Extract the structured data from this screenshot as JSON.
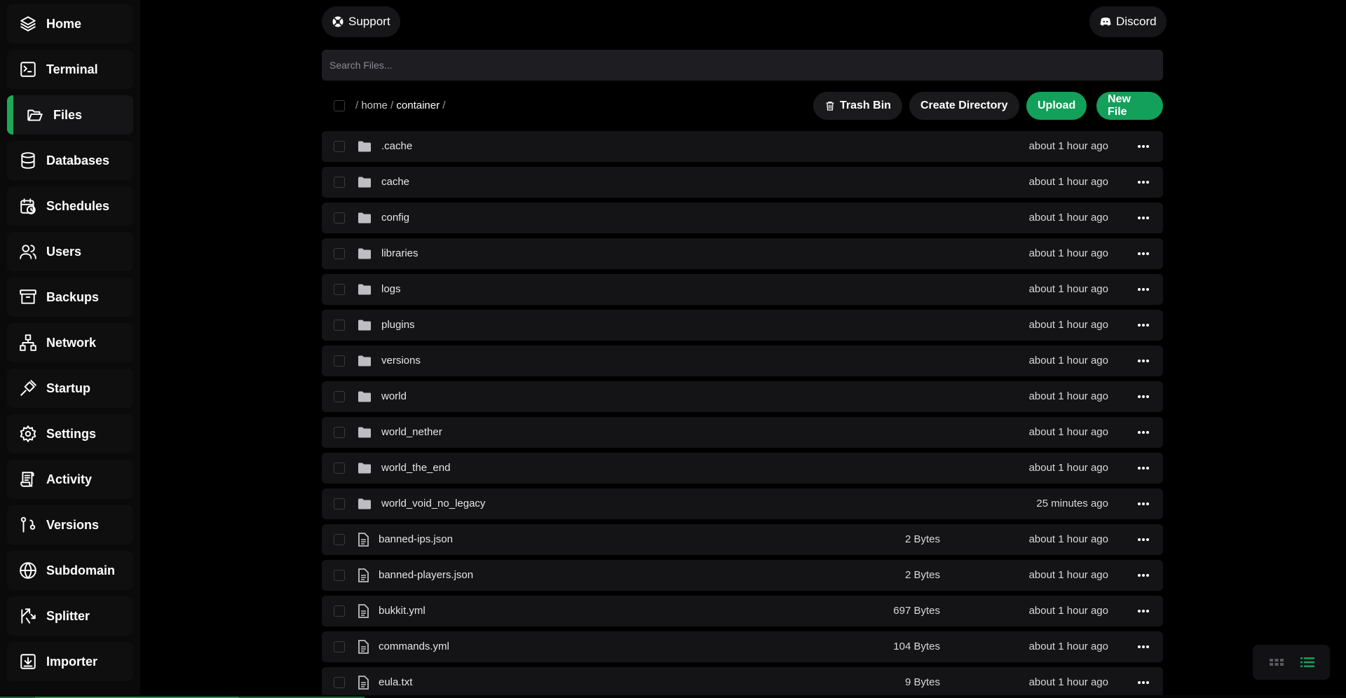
{
  "sidebar": {
    "items": [
      {
        "label": "Home",
        "icon": "layers-icon",
        "active": false
      },
      {
        "label": "Terminal",
        "icon": "terminal-icon",
        "active": false
      },
      {
        "label": "Files",
        "icon": "folder-open-icon",
        "active": true
      },
      {
        "label": "Databases",
        "icon": "database-icon",
        "active": false
      },
      {
        "label": "Schedules",
        "icon": "calendar-clock-icon",
        "active": false
      },
      {
        "label": "Users",
        "icon": "users-icon",
        "active": false
      },
      {
        "label": "Backups",
        "icon": "archive-icon",
        "active": false
      },
      {
        "label": "Network",
        "icon": "network-icon",
        "active": false
      },
      {
        "label": "Startup",
        "icon": "plug-icon",
        "active": false
      },
      {
        "label": "Settings",
        "icon": "gear-icon",
        "active": false
      },
      {
        "label": "Activity",
        "icon": "scroll-icon",
        "active": false
      },
      {
        "label": "Versions",
        "icon": "git-branch-icon",
        "active": false
      },
      {
        "label": "Subdomain",
        "icon": "globe-icon",
        "active": false
      },
      {
        "label": "Splitter",
        "icon": "split-icon",
        "active": false
      },
      {
        "label": "Importer",
        "icon": "import-icon",
        "active": false
      }
    ]
  },
  "header": {
    "support_label": "Support",
    "discord_label": "Discord"
  },
  "search": {
    "placeholder": "Search Files..."
  },
  "breadcrumb": {
    "sep": "/",
    "home": "home",
    "current": "container"
  },
  "toolbar": {
    "trash_label": "Trash Bin",
    "create_dir_label": "Create Directory",
    "upload_label": "Upload",
    "new_file_label": "New File"
  },
  "files": [
    {
      "name": ".cache",
      "type": "folder",
      "size": "",
      "modified": "about 1 hour ago"
    },
    {
      "name": "cache",
      "type": "folder",
      "size": "",
      "modified": "about 1 hour ago"
    },
    {
      "name": "config",
      "type": "folder",
      "size": "",
      "modified": "about 1 hour ago"
    },
    {
      "name": "libraries",
      "type": "folder",
      "size": "",
      "modified": "about 1 hour ago"
    },
    {
      "name": "logs",
      "type": "folder",
      "size": "",
      "modified": "about 1 hour ago"
    },
    {
      "name": "plugins",
      "type": "folder",
      "size": "",
      "modified": "about 1 hour ago"
    },
    {
      "name": "versions",
      "type": "folder",
      "size": "",
      "modified": "about 1 hour ago"
    },
    {
      "name": "world",
      "type": "folder",
      "size": "",
      "modified": "about 1 hour ago"
    },
    {
      "name": "world_nether",
      "type": "folder",
      "size": "",
      "modified": "about 1 hour ago"
    },
    {
      "name": "world_the_end",
      "type": "folder",
      "size": "",
      "modified": "about 1 hour ago"
    },
    {
      "name": "world_void_no_legacy",
      "type": "folder",
      "size": "",
      "modified": "25 minutes ago"
    },
    {
      "name": "banned-ips.json",
      "type": "file",
      "size": "2 Bytes",
      "modified": "about 1 hour ago"
    },
    {
      "name": "banned-players.json",
      "type": "file",
      "size": "2 Bytes",
      "modified": "about 1 hour ago"
    },
    {
      "name": "bukkit.yml",
      "type": "file",
      "size": "697 Bytes",
      "modified": "about 1 hour ago"
    },
    {
      "name": "commands.yml",
      "type": "file",
      "size": "104 Bytes",
      "modified": "about 1 hour ago"
    },
    {
      "name": "eula.txt",
      "type": "file",
      "size": "9 Bytes",
      "modified": "about 1 hour ago"
    }
  ],
  "colors": {
    "accent": "#12a05a",
    "active_bar": "#1fa857",
    "row_bg": "#141416"
  }
}
